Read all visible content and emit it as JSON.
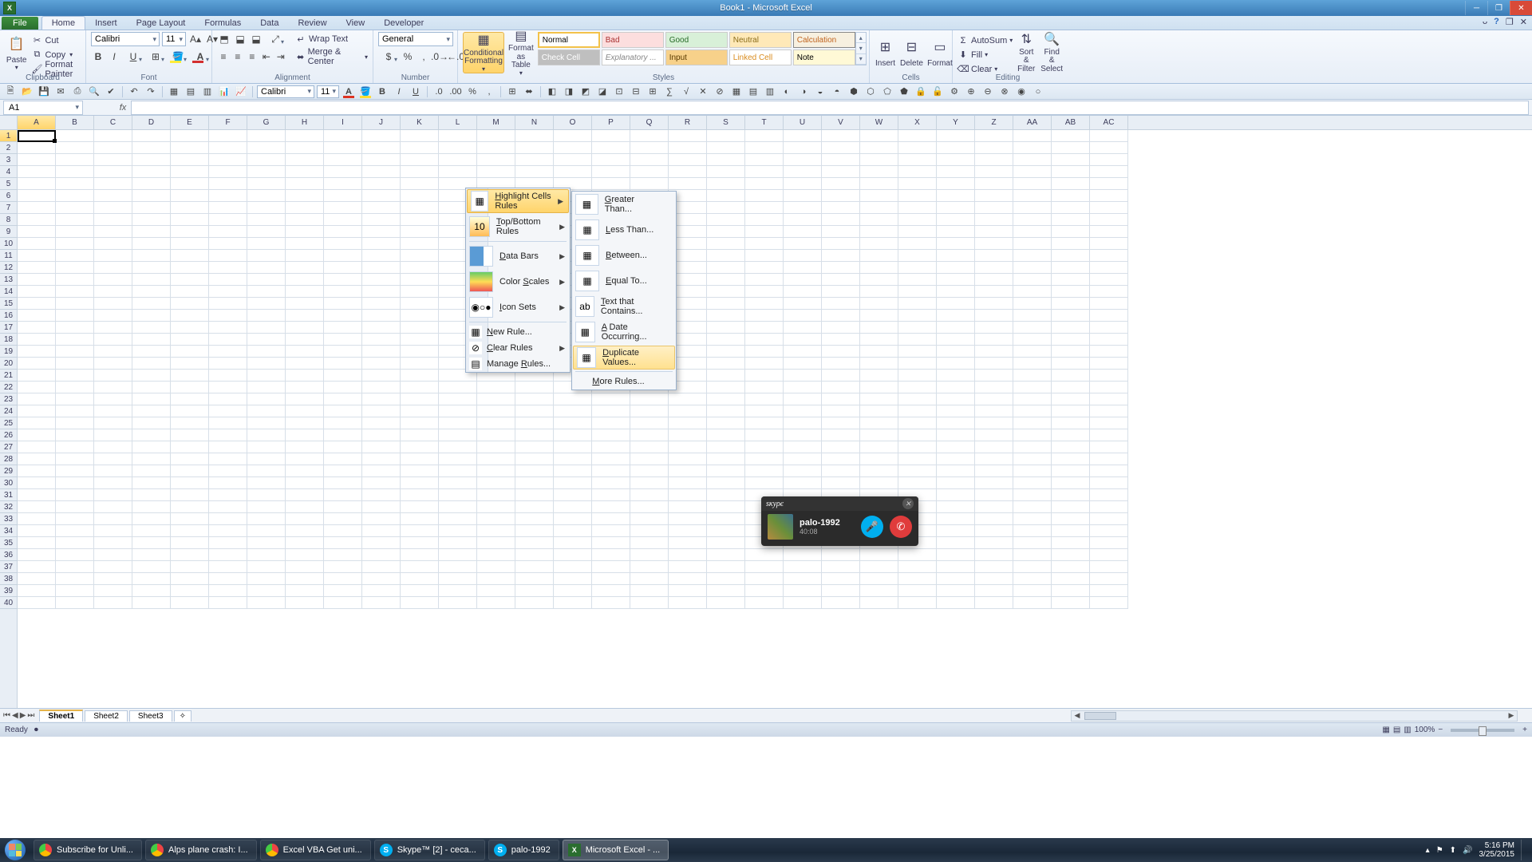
{
  "title": "Book1 - Microsoft Excel",
  "tabs": {
    "file": "File",
    "list": [
      "Home",
      "Insert",
      "Page Layout",
      "Formulas",
      "Data",
      "Review",
      "View",
      "Developer"
    ],
    "active": "Home"
  },
  "clipboard": {
    "label": "Clipboard",
    "paste": "Paste",
    "cut": "Cut",
    "copy": "Copy",
    "fp": "Format Painter"
  },
  "font": {
    "label": "Font",
    "name": "Calibri",
    "size": "11"
  },
  "alignment": {
    "label": "Alignment",
    "wrap": "Wrap Text",
    "merge": "Merge & Center"
  },
  "number": {
    "label": "Number",
    "format": "General"
  },
  "styles": {
    "label": "Styles",
    "cond": "Conditional Formatting",
    "fat": "Format as Table",
    "cells": [
      "Normal",
      "Bad",
      "Good",
      "Neutral",
      "Calculation",
      "Check Cell",
      "Explanatory ...",
      "Input",
      "Linked Cell",
      "Note"
    ]
  },
  "cells_group": {
    "label": "Cells",
    "insert": "Insert",
    "delete": "Delete",
    "format": "Format"
  },
  "editing": {
    "label": "Editing",
    "sum": "AutoSum",
    "fill": "Fill",
    "clear": "Clear",
    "sort": "Sort & Filter",
    "find": "Find & Select"
  },
  "namebox": "A1",
  "columns": [
    "A",
    "B",
    "C",
    "D",
    "E",
    "F",
    "G",
    "H",
    "I",
    "J",
    "K",
    "L",
    "M",
    "N",
    "O",
    "P",
    "Q",
    "R",
    "S",
    "T",
    "U",
    "V",
    "W",
    "X",
    "Y",
    "Z",
    "AA",
    "AB",
    "AC"
  ],
  "row_count": 40,
  "cf_menu": {
    "items": [
      "Highlight Cells Rules",
      "Top/Bottom Rules",
      "Data Bars",
      "Color Scales",
      "Icon Sets"
    ],
    "extra": [
      "New Rule...",
      "Clear Rules",
      "Manage Rules..."
    ]
  },
  "hcr_menu": {
    "items": [
      "Greater Than...",
      "Less Than...",
      "Between...",
      "Equal To...",
      "Text that Contains...",
      "A Date Occurring...",
      "Duplicate Values..."
    ],
    "more": "More Rules..."
  },
  "skype": {
    "brand": "Skype",
    "name": "palo-1992",
    "dur": "40:08"
  },
  "sheets": [
    "Sheet1",
    "Sheet2",
    "Sheet3"
  ],
  "status": "Ready",
  "zoom": "100%",
  "taskbar": {
    "items": [
      {
        "label": "Subscribe for Unli...",
        "icon": "chrome"
      },
      {
        "label": "Alps plane crash: I...",
        "icon": "chrome"
      },
      {
        "label": "Excel VBA Get uni...",
        "icon": "chrome"
      },
      {
        "label": "Skype™ [2] - ceca...",
        "icon": "skype"
      },
      {
        "label": "palo-1992",
        "icon": "skype"
      },
      {
        "label": "Microsoft Excel - ...",
        "icon": "excel",
        "active": true
      }
    ],
    "time": "5:16 PM",
    "date": "3/25/2015"
  },
  "qat_font": {
    "name": "Calibri",
    "size": "11"
  }
}
